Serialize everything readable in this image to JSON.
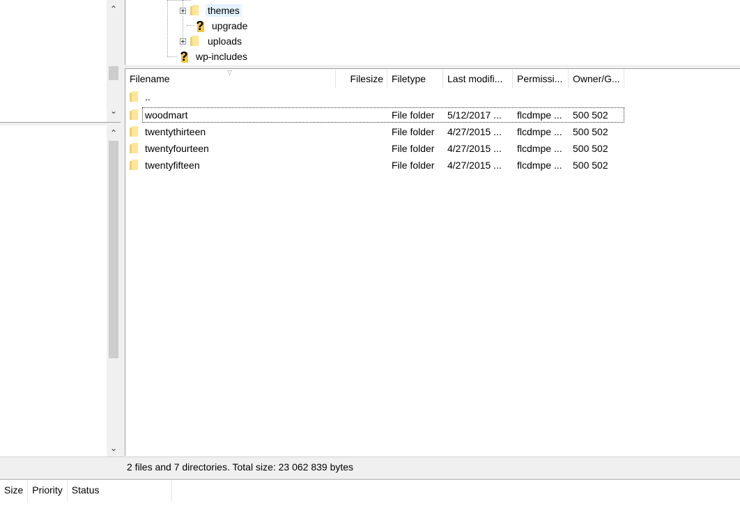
{
  "tree": {
    "items": [
      {
        "label": "themes",
        "icon": "folder-icon",
        "expandable": true,
        "selected": true
      },
      {
        "label": "upgrade",
        "icon": "question-icon",
        "expandable": false,
        "selected": false
      },
      {
        "label": "uploads",
        "icon": "folder-icon",
        "expandable": true,
        "selected": false
      },
      {
        "label": "wp-includes",
        "icon": "question-icon",
        "expandable": false,
        "selected": false
      }
    ],
    "question_glyph": "?"
  },
  "filelist": {
    "columns": [
      "Filename",
      "Filesize",
      "Filetype",
      "Last modifi...",
      "Permissi...",
      "Owner/G..."
    ],
    "sort_indicator": "▽",
    "rows": [
      {
        "name": "..",
        "size": "",
        "type": "",
        "modified": "",
        "perms": "",
        "owner": ""
      },
      {
        "name": "woodmart",
        "size": "",
        "type": "File folder",
        "modified": "5/12/2017 ...",
        "perms": "flcdmpe ...",
        "owner": "500 502"
      },
      {
        "name": "twentythirteen",
        "size": "",
        "type": "File folder",
        "modified": "4/27/2015 ...",
        "perms": "flcdmpe ...",
        "owner": "500 502"
      },
      {
        "name": "twentyfourteen",
        "size": "",
        "type": "File folder",
        "modified": "4/27/2015 ...",
        "perms": "flcdmpe ...",
        "owner": "500 502"
      },
      {
        "name": "twentyfifteen",
        "size": "",
        "type": "File folder",
        "modified": "4/27/2015 ...",
        "perms": "flcdmpe ...",
        "owner": "500 502"
      }
    ]
  },
  "status": {
    "summary": "2 files and 7 directories. Total size: 23 062 839 bytes"
  },
  "queue": {
    "columns": [
      "Size",
      "Priority",
      "Status"
    ]
  },
  "scroll": {
    "up_glyph": "⌃",
    "down_glyph": "⌄"
  }
}
